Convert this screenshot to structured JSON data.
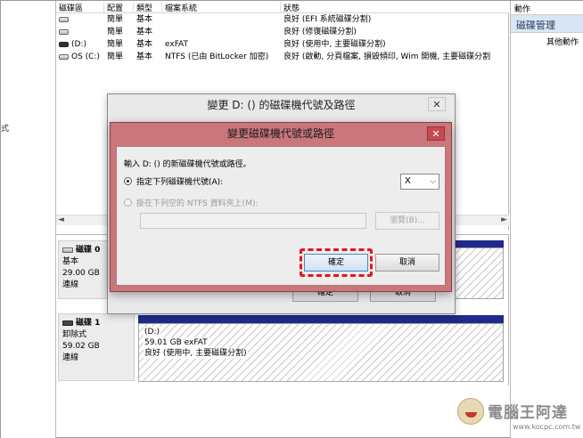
{
  "left_gutter": {
    "clipped_char": "式"
  },
  "volume_table": {
    "columns": [
      "磁碟區",
      "配置",
      "類型",
      "檔案系統",
      "狀態"
    ],
    "rows": [
      {
        "name": "",
        "layout": "簡單",
        "type": "基本",
        "fs": "",
        "status": "良好 (EFI 系統磁碟分割)",
        "icon": "drive-icon"
      },
      {
        "name": "",
        "layout": "簡單",
        "type": "基本",
        "fs": "",
        "status": "良好 (修復磁碟分割)",
        "icon": "drive-icon"
      },
      {
        "name": "(D:)",
        "layout": "簡單",
        "type": "基本",
        "fs": "exFAT",
        "status": "良好 (使用中, 主要磁碟分割)",
        "icon": "removable-drive-icon"
      },
      {
        "name": "OS (C:)",
        "layout": "簡單",
        "type": "基本",
        "fs": "NTFS (已由 BitLocker 加密)",
        "status": "良好 (啟動, 分頁檔案, 損毀傾印, Wim 開機, 主要磁碟分割",
        "icon": "drive-icon"
      }
    ],
    "scroll_left": "◄",
    "scroll_right": "►"
  },
  "disks": [
    {
      "name": "磁碟 0",
      "kind": "基本",
      "size": "29.00 GB",
      "state": "連線"
    },
    {
      "name": "磁碟 1",
      "kind": "卸除式",
      "size": "59.02 GB",
      "state": "連線",
      "partition": {
        "label": "(D:)",
        "detail": "59.01 GB exFAT",
        "status": "良好 (使用中, 主要磁碟分割)"
      }
    }
  ],
  "actions_pane": {
    "header": "動作",
    "section": "磁碟管理",
    "more": "其他動作"
  },
  "outer_dialog": {
    "title": "變更 D: () 的磁碟機代號及路徑",
    "close": "✕",
    "ok": "確定",
    "cancel": "取消"
  },
  "inner_dialog": {
    "title": "變更磁碟機代號或路徑",
    "close": "✕",
    "prompt": "輸入 D: () 的新磁碟機代號或路徑。",
    "option_letter": "指定下列磁碟機代號(A):",
    "drive_letter": "X",
    "option_folder": "掛在下列空的 NTFS 資料夾上(M):",
    "browse": "瀏覽(B)...",
    "ok": "確定",
    "cancel": "取消"
  },
  "watermark": {
    "title": "電腦王阿達",
    "url": "www.kocpc.com.tw"
  },
  "colors": {
    "dialog_tint": "#c9777c",
    "highlight": "#e8171e",
    "partition_bar": "#1f2b8c",
    "actions_section": "#dbe6f4"
  }
}
